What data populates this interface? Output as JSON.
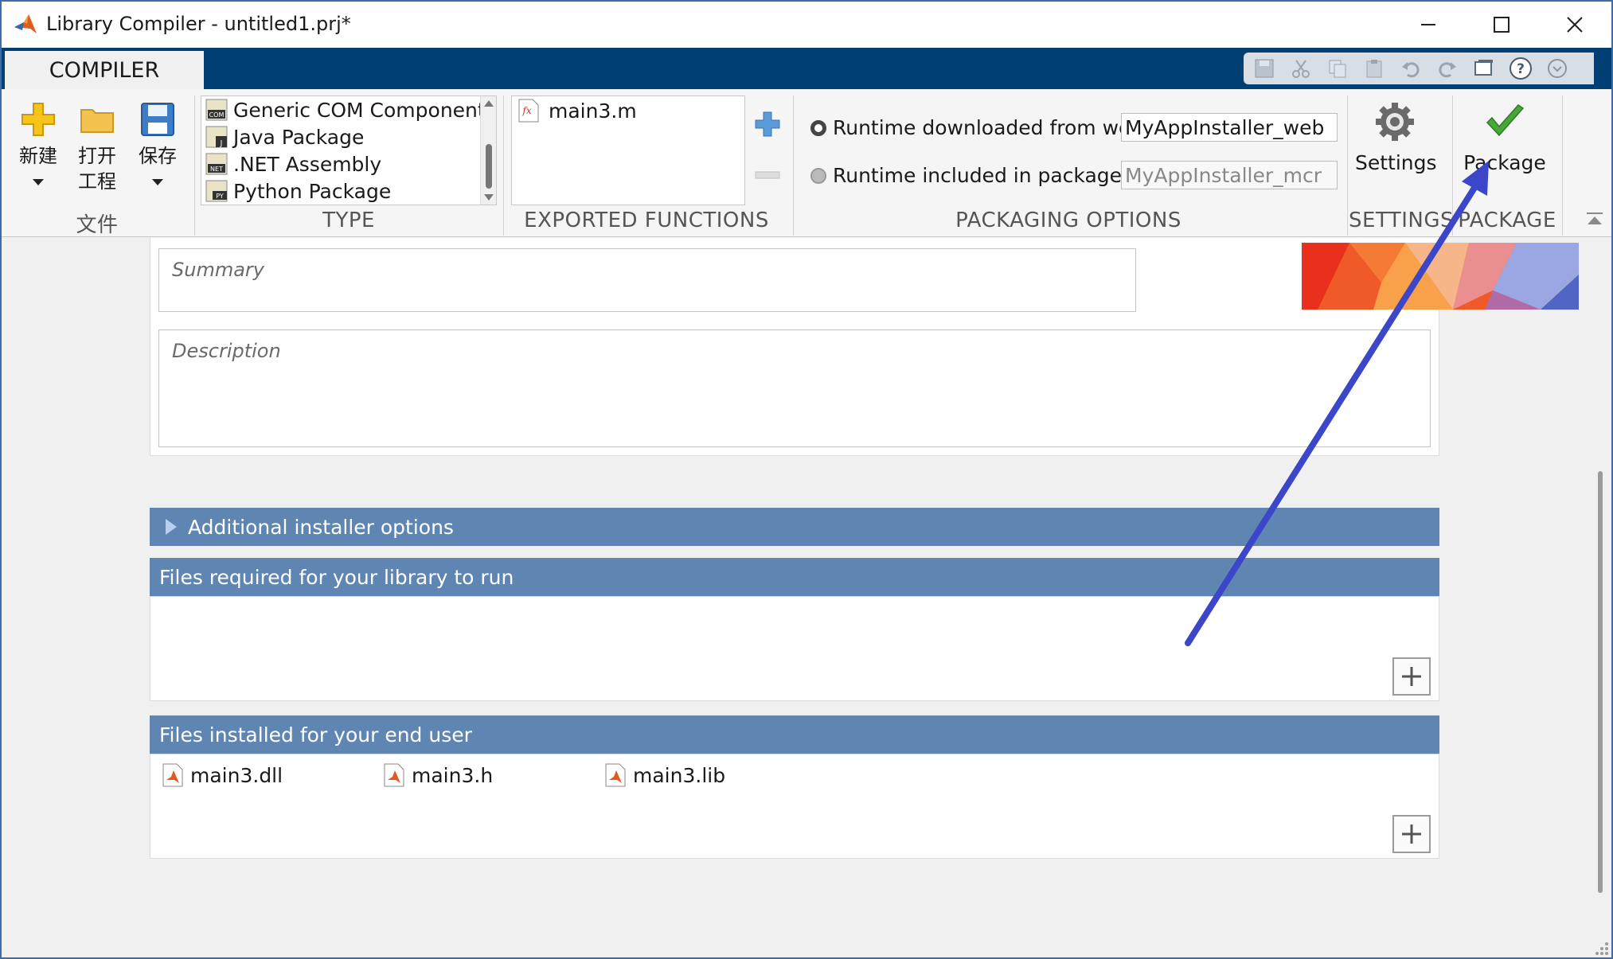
{
  "window": {
    "title": "Library Compiler - untitled1.prj*"
  },
  "ribbon": {
    "tab_label": "COMPILER",
    "file_group": {
      "new_label": "新建",
      "open_label_line1": "打开",
      "open_label_line2": "工程",
      "save_label": "保存",
      "section_label": "文件"
    },
    "type_group": {
      "items": [
        "Generic COM Component",
        "Java Package",
        ".NET Assembly",
        "Python Package"
      ],
      "section_label": "TYPE"
    },
    "exported_functions": {
      "items": [
        "main3.m"
      ],
      "section_label": "EXPORTED FUNCTIONS"
    },
    "packaging_options": {
      "web_label": "Runtime downloaded from web",
      "web_value": "MyAppInstaller_web",
      "included_label": "Runtime included in package",
      "included_value": "MyAppInstaller_mcr",
      "section_label": "PACKAGING OPTIONS"
    },
    "settings": {
      "button_label": "Settings",
      "section_label": "SETTINGS"
    },
    "package": {
      "button_label": "Package",
      "section_label": "PACKAGE"
    }
  },
  "form": {
    "summary_placeholder": "Summary",
    "description_placeholder": "Description"
  },
  "sections": {
    "additional_installer_options": "Additional installer options",
    "files_required": "Files required for your library to run",
    "files_installed": "Files installed for your end user"
  },
  "installed_files": [
    "main3.dll",
    "main3.h",
    "main3.lib"
  ],
  "colors": {
    "ribbon_header": "#003f73",
    "section_bar": "#5f86b3",
    "annotation_arrow": "#3b46c9",
    "package_check": "#4aa63a"
  }
}
